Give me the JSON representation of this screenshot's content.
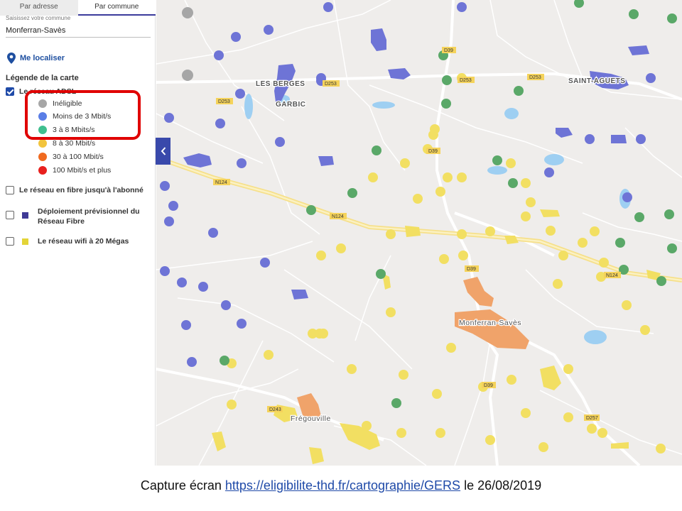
{
  "tabs": [
    "Par adresse",
    "Par commune"
  ],
  "search": {
    "label": "Saisissez votre commune",
    "value": "Monferran-Savès"
  },
  "locate_label": "Me localiser",
  "legend_title": "Légende de la carte",
  "layers": {
    "adsl": {
      "label": "Le réseau ADSL",
      "checked": true
    },
    "fibre": {
      "label": "Le réseau en fibre jusqu'à l'abonné",
      "checked": false
    },
    "deploiement": {
      "label_line1": "Déploiement prévisionnel du",
      "label_line2": "Réseau Fibre",
      "checked": false,
      "color": "#3f3a96"
    },
    "wifi": {
      "label": "Le réseau wifi à 20 Mégas",
      "checked": false,
      "color": "#e3d437"
    }
  },
  "adsl_legend": [
    {
      "label": "Inéligible",
      "color": "#a6a6a6"
    },
    {
      "label": "Moins de 3 Mbit/s",
      "color": "#5a7ee6"
    },
    {
      "label": "3 à 8 Mbits/s",
      "color": "#3fbf8f"
    },
    {
      "label": "8 à 30 Mbit/s",
      "color": "#f2c43d"
    },
    {
      "label": "30 à 100 Mbit/s",
      "color": "#f06a1f"
    },
    {
      "label": "100 Mbit/s et plus",
      "color": "#e8201e"
    }
  ],
  "map": {
    "places": [
      "LES BERGES",
      "GARBIC",
      "SAINT-AGUETS",
      "Monferran-Savès",
      "Frégouville"
    ],
    "road_labels": [
      "D39",
      "D253",
      "D253",
      "D253",
      "D253",
      "D39",
      "N124",
      "N124",
      "N124",
      "D39",
      "D39",
      "D243",
      "D257"
    ]
  },
  "caption": {
    "prefix": "Capture écran ",
    "link": "https://eligibilite-thd.fr/cartographie/GERS",
    "suffix": " le 26/08/2019"
  }
}
